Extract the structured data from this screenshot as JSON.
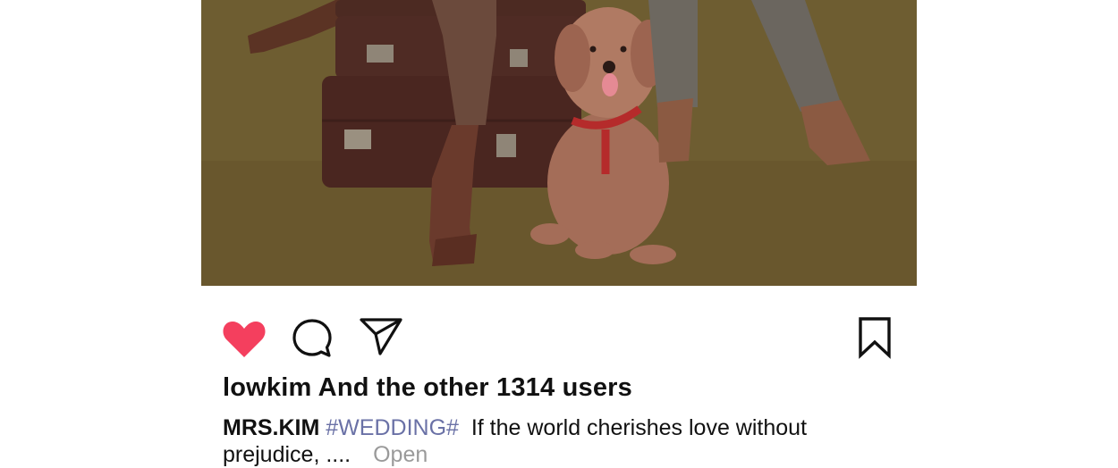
{
  "post": {
    "photo_icon": "photo",
    "likes_text": "lowkim And the other 1314 users",
    "caption": {
      "username": "MRS.KIM",
      "hashtag": "#WEDDING#",
      "text_line1": "If the world cherishes love without",
      "text_line2": "prejudice, ....",
      "open_label": "Open"
    }
  },
  "actions": {
    "like": {
      "icon": "heart-icon",
      "color": "#f43f5e",
      "active": true
    },
    "comment": {
      "icon": "comment-icon"
    },
    "share": {
      "icon": "send-icon"
    },
    "save": {
      "icon": "bookmark-icon"
    }
  },
  "colors": {
    "hashtag": "#6a71a6",
    "muted": "#9a9a9a",
    "heart": "#f43f5e"
  }
}
